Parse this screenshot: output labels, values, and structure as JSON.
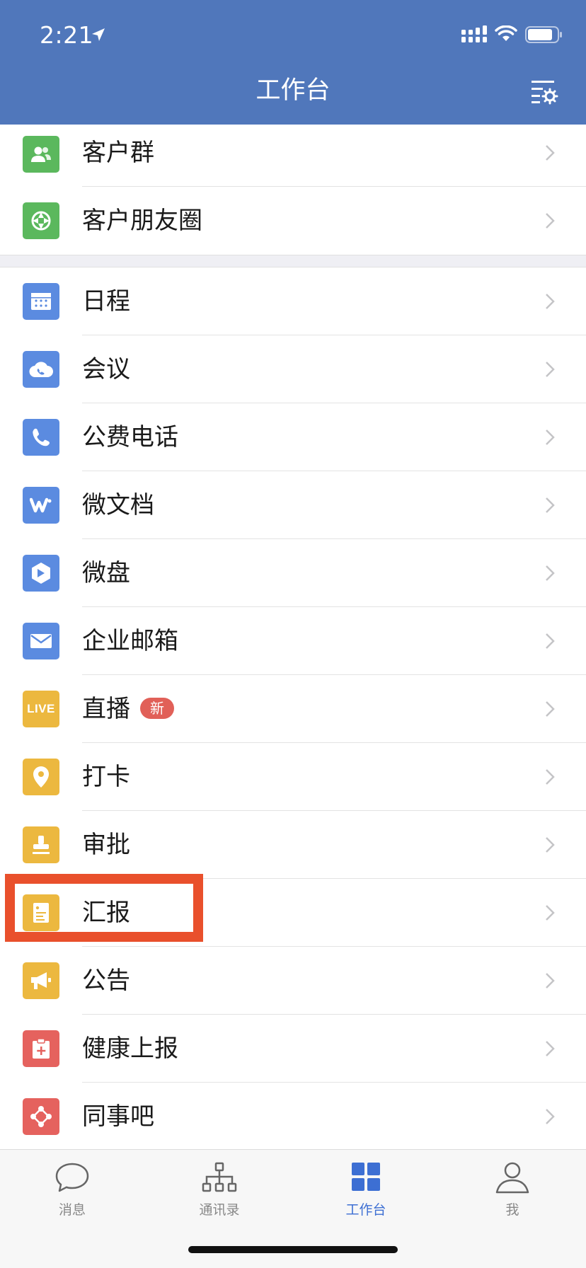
{
  "status_bar": {
    "time": "2:21"
  },
  "header": {
    "title": "工作台"
  },
  "sections": [
    {
      "items": [
        {
          "label": "客户群",
          "icon": "customer-group-icon",
          "color": "#5bb85d"
        },
        {
          "label": "客户朋友圈",
          "icon": "customer-moments-icon",
          "color": "#5bb85d"
        }
      ]
    },
    {
      "items": [
        {
          "label": "日程",
          "icon": "calendar-icon",
          "color": "#5b8be0"
        },
        {
          "label": "会议",
          "icon": "cloud-phone-icon",
          "color": "#5b8be0"
        },
        {
          "label": "公费电话",
          "icon": "phone-icon",
          "color": "#5b8be0"
        },
        {
          "label": "微文档",
          "icon": "doc-w-icon",
          "color": "#5b8be0"
        },
        {
          "label": "微盘",
          "icon": "drive-icon",
          "color": "#5b8be0"
        },
        {
          "label": "企业邮箱",
          "icon": "mail-icon",
          "color": "#5b8be0"
        },
        {
          "label": "直播",
          "icon": "live-icon",
          "icon_text": "LIVE",
          "badge": "新",
          "color": "#ecb83f"
        },
        {
          "label": "打卡",
          "icon": "location-pin-icon",
          "color": "#ecb83f"
        },
        {
          "label": "审批",
          "icon": "stamp-icon",
          "color": "#ecb83f"
        },
        {
          "label": "汇报",
          "icon": "report-icon",
          "color": "#ecb83f",
          "highlighted": true
        },
        {
          "label": "公告",
          "icon": "megaphone-icon",
          "color": "#ecb83f"
        },
        {
          "label": "健康上报",
          "icon": "health-clipboard-icon",
          "color": "#e5625e"
        },
        {
          "label": "同事吧",
          "icon": "colleague-network-icon",
          "color": "#e5625e"
        }
      ]
    }
  ],
  "tabbar": {
    "tabs": [
      {
        "label": "消息",
        "icon": "chat-bubble-icon"
      },
      {
        "label": "通讯录",
        "icon": "org-chart-icon"
      },
      {
        "label": "工作台",
        "icon": "grid-icon",
        "active": true
      },
      {
        "label": "我",
        "icon": "person-icon"
      }
    ]
  },
  "colors": {
    "header_bg": "#5077bb",
    "active_tab": "#3d6fd3",
    "highlight_box": "#e9502c",
    "badge": "#e16058"
  }
}
